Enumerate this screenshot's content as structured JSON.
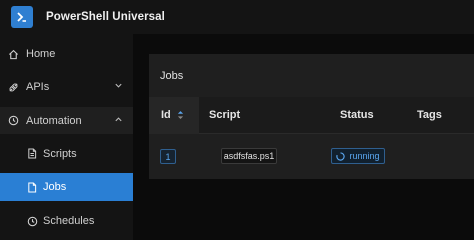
{
  "header": {
    "title": "PowerShell Universal",
    "accent": "#2a7fd4"
  },
  "sidebar": {
    "items": [
      {
        "label": "Home",
        "icon": "home-icon"
      },
      {
        "label": "APIs",
        "icon": "api-icon",
        "expandable": true
      },
      {
        "label": "Automation",
        "icon": "automation-icon",
        "expanded": true
      },
      {
        "label": "Scripts",
        "icon": "script-file-icon"
      },
      {
        "label": "Jobs",
        "icon": "jobs-icon",
        "selected": true
      },
      {
        "label": "Schedules",
        "icon": "clock-icon"
      }
    ]
  },
  "main": {
    "card_title": "Jobs",
    "table": {
      "columns": [
        "Id",
        "Script",
        "Status",
        "Tags"
      ],
      "rows": [
        {
          "id": "1",
          "script": "asdfsfas.ps1",
          "status": "running"
        }
      ]
    }
  }
}
